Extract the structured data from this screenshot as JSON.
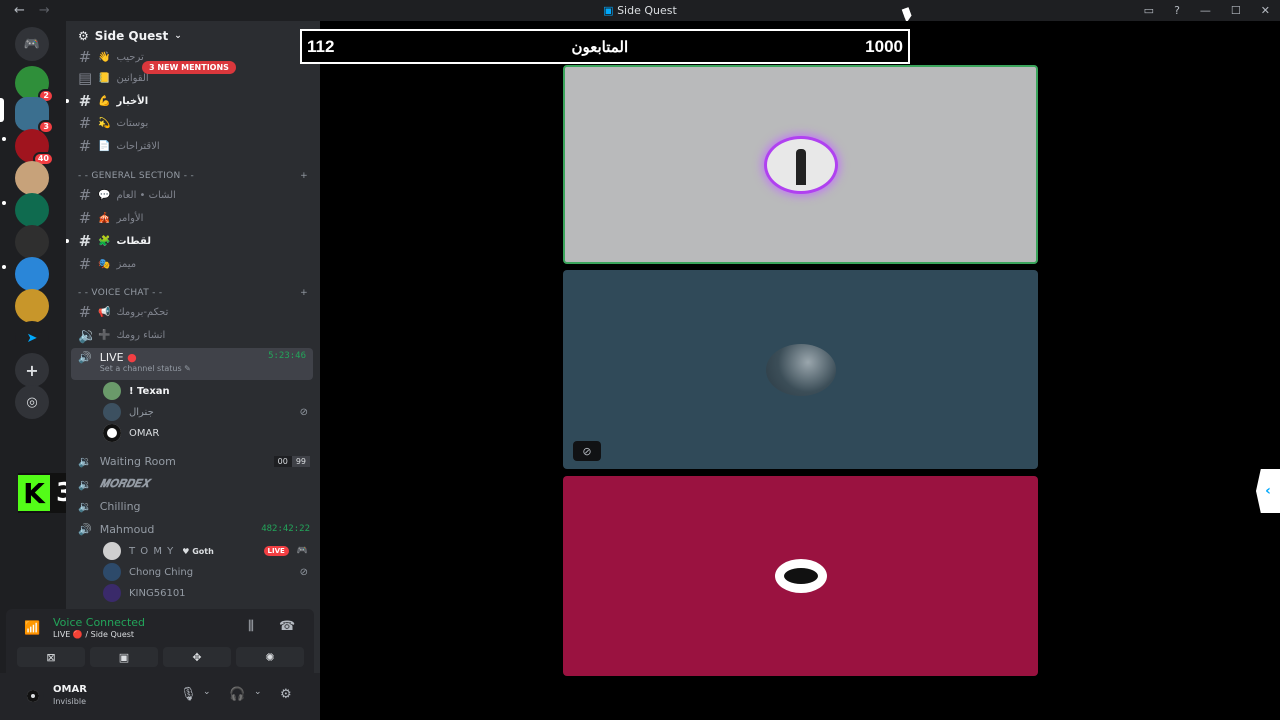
{
  "window": {
    "title": "Side Quest",
    "back": "←",
    "forward": "→"
  },
  "server": {
    "name": "Side Quest",
    "mentions": "3 NEW MENTIONS"
  },
  "guild_badges": [
    "2",
    "3",
    "40"
  ],
  "top_channels": [
    {
      "name": "ترحيب",
      "emoji": "👋"
    },
    {
      "name": "القوانين",
      "emoji": "📒"
    },
    {
      "name": "الأخبار",
      "emoji": "💪"
    },
    {
      "name": "بوستات",
      "emoji": "💫"
    },
    {
      "name": "الاقتراحات",
      "emoji": "📄"
    }
  ],
  "general_section": {
    "label": "- - GENERAL SECTION - -",
    "channels": [
      {
        "name": "الشات • العام",
        "emoji": "💬"
      },
      {
        "name": "الأوامر",
        "emoji": "🎪"
      },
      {
        "name": "لقطات",
        "emoji": "🧩"
      },
      {
        "name": "ميمز",
        "emoji": "🎭"
      }
    ]
  },
  "voice_section": {
    "label": "- - VOICE CHAT - -",
    "channels": [
      {
        "name": "تحكم-برومك",
        "emoji": "📢"
      },
      {
        "name": "انشاء رومك",
        "emoji": "➕"
      }
    ]
  },
  "voice_channels": {
    "live": {
      "name": "LIVE",
      "timer": "5:23:46",
      "status": "Set a channel status"
    },
    "live_users": [
      "! Texan",
      "جنرال",
      "OMAR"
    ],
    "waiting_room": {
      "name": "Waiting Room",
      "count_a": "00",
      "count_b": "99"
    },
    "mordex": "𝑴𝑶𝑹𝑫𝑬𝑿",
    "chilling": "Chilling",
    "mahmoud": {
      "name": "Mahmoud",
      "timer": "482:42:22"
    },
    "mahmoud_users": [
      "T O M Y",
      "Chong Ching",
      "KING56101"
    ],
    "tomy_tag": "Goth",
    "live_tag": "LIVE"
  },
  "kick_badge": {
    "letter": "K",
    "number": "3"
  },
  "voice_panel": {
    "status": "Voice Connected",
    "sub": "LIVE 🔴 / Side Quest"
  },
  "user": {
    "name": "OMAR",
    "status": "Invisible"
  },
  "counter": {
    "left": "112",
    "center": "المتابعون",
    "right": "1000"
  }
}
